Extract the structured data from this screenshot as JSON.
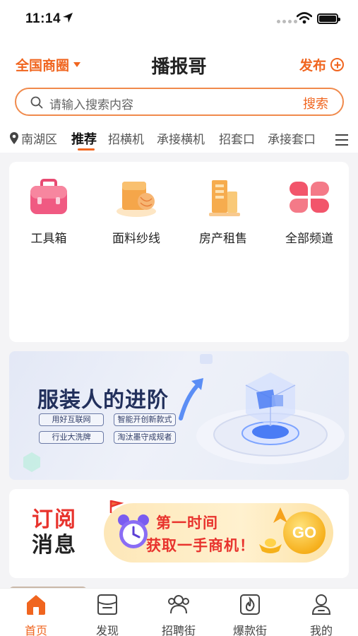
{
  "status": {
    "time": "11:14"
  },
  "header": {
    "region": "全国商圈",
    "title": "播报哥",
    "publish": "发布"
  },
  "search": {
    "placeholder": "请输入搜索内容",
    "button": "搜索"
  },
  "tabs": {
    "location": "南湖区",
    "items": [
      "推荐",
      "招横机",
      "承接横机",
      "招套口",
      "承接套口"
    ],
    "active": "推荐"
  },
  "grid": {
    "items": [
      {
        "label": "工具箱",
        "icon": "toolbox-icon"
      },
      {
        "label": "面料纱线",
        "icon": "fabric-yarn-icon"
      },
      {
        "label": "房产租售",
        "icon": "building-icon"
      },
      {
        "label": "全部频道",
        "icon": "all-channels-icon"
      }
    ]
  },
  "banner": {
    "title": "服装人的进阶",
    "tags": [
      "用好互联网",
      "智能开创新款式",
      "行业大洗牌",
      "淘汰墨守成规者"
    ]
  },
  "subscribe": {
    "title_line1": "订阅",
    "title_line2": "消息",
    "line1": "第一时间",
    "line2": "获取一手商机！",
    "go": "GO"
  },
  "tabbar": {
    "items": [
      {
        "label": "首页",
        "icon": "home-icon",
        "active": true
      },
      {
        "label": "发现",
        "icon": "discover-icon"
      },
      {
        "label": "招聘街",
        "icon": "recruit-icon"
      },
      {
        "label": "爆款街",
        "icon": "hot-icon"
      },
      {
        "label": "我的",
        "icon": "profile-icon"
      }
    ]
  },
  "colors": {
    "accent": "#f0651f",
    "red": "#e8332d"
  }
}
